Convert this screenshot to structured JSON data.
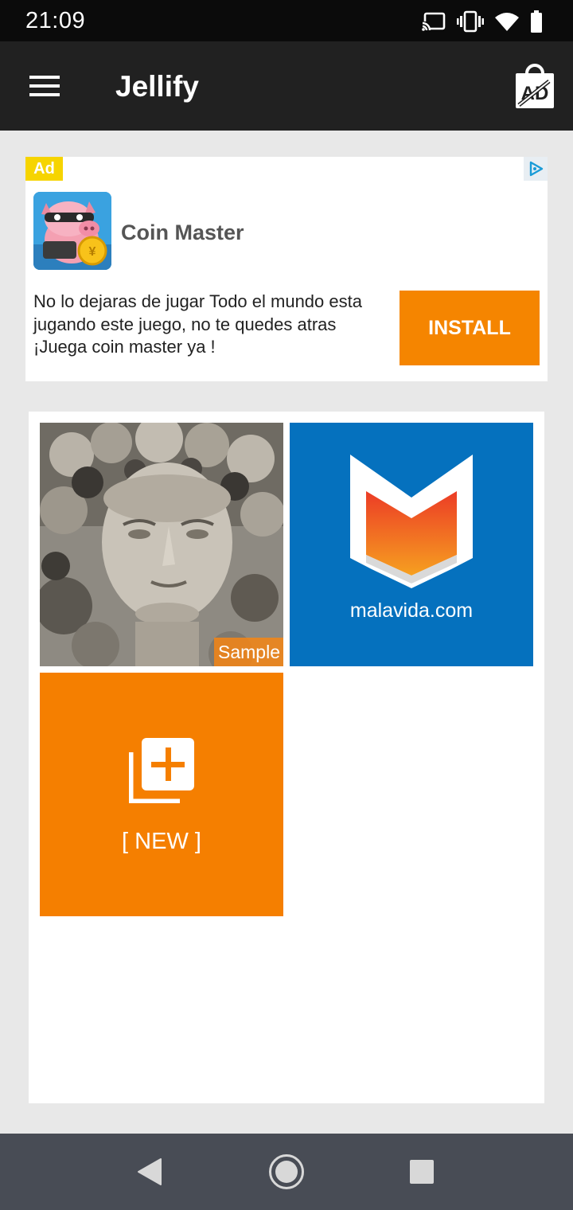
{
  "status_bar": {
    "time": "21:09",
    "icons": [
      "cast-icon",
      "vibrate-icon",
      "wifi-icon",
      "battery-icon"
    ]
  },
  "app_bar": {
    "title": "Jellify",
    "menu_icon": "hamburger-menu-icon",
    "remove_ads_icon": "remove-ads-icon"
  },
  "ad": {
    "badge": "Ad",
    "app_name": "Coin Master",
    "description": "No lo dejaras de jugar Todo el mundo esta jugando este juego, no te quedes atras ¡Juega coin master ya !",
    "install_label": "INSTALL",
    "colors": {
      "badge": "#f6d400",
      "install": "#f58500"
    }
  },
  "gallery": {
    "items": [
      {
        "kind": "image",
        "subject": "stone statue face",
        "label": "Sample"
      },
      {
        "kind": "image",
        "subject": "malavida logo",
        "caption": "malavida.com"
      },
      {
        "kind": "new",
        "icon": "add-to-library-icon",
        "label": "[ NEW ]"
      }
    ],
    "colors": {
      "new_tile": "#f57f00",
      "malavida_bg": "#0571be"
    }
  },
  "nav_bar": {
    "buttons": [
      "back-icon",
      "home-icon",
      "recents-icon"
    ]
  }
}
